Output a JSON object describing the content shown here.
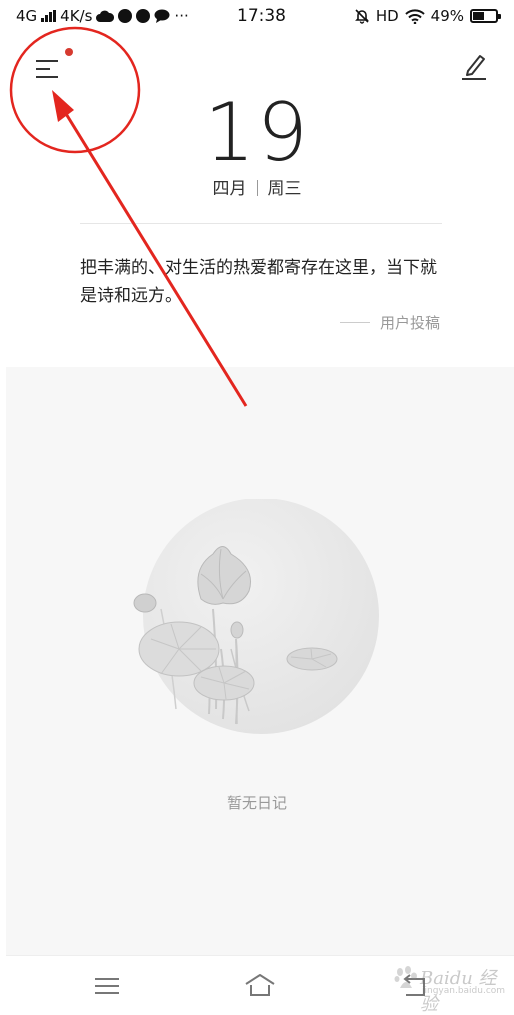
{
  "status_bar": {
    "network": "4G",
    "speed": "4K/s",
    "time": "17:38",
    "hd": "HD",
    "battery": "49%",
    "battery_level": 0.49,
    "icons": [
      "signal-icon",
      "cloud-icon",
      "qq-icon",
      "qq-icon",
      "message-icon",
      "more-dots-icon",
      "mute-bell-icon",
      "wifi-icon",
      "battery-icon"
    ]
  },
  "header": {
    "menu_icon": "menu-icon",
    "edit_icon": "edit-icon",
    "has_badge": true,
    "badge_color": "#d63a2f"
  },
  "date": {
    "day": "19",
    "month": "四月",
    "weekday": "周三"
  },
  "quote": {
    "text": "把丰满的、对生活的热爱都寄存在这里，当下就是诗和远方。",
    "source": "用户投稿"
  },
  "empty_state": {
    "illustration": "lotus-illustration",
    "text": "暂无日记"
  },
  "bottom_nav": {
    "items": [
      {
        "icon": "menu-icon"
      },
      {
        "icon": "home-icon"
      },
      {
        "icon": "back-icon"
      }
    ]
  },
  "watermark": {
    "text": "Baidu 经验",
    "url": "jingyan.baidu.com"
  },
  "annotation": {
    "color": "#e3261f",
    "shapes": [
      "circle-around-menu",
      "arrow-to-menu"
    ]
  }
}
